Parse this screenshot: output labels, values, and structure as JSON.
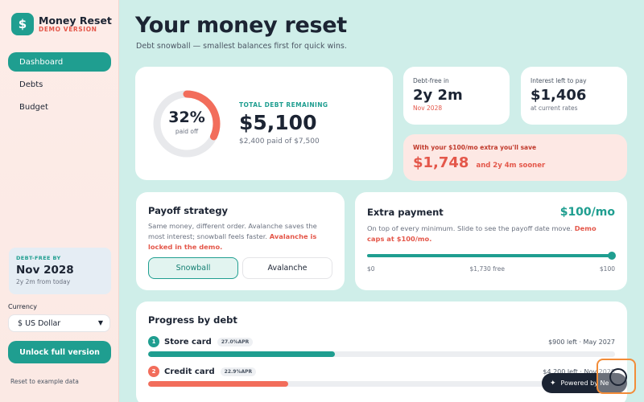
{
  "brand": {
    "logo_glyph": "$",
    "name": "Money Reset",
    "subtitle": "DEMO VERSION"
  },
  "nav": {
    "items": [
      {
        "label": "Dashboard",
        "active": true
      },
      {
        "label": "Debts",
        "active": false
      },
      {
        "label": "Budget",
        "active": false
      }
    ]
  },
  "sidebar_card": {
    "label": "DEBT-FREE BY",
    "value": "Nov 2028",
    "sub": "2y 2m from today"
  },
  "currency": {
    "label": "Currency",
    "selected": "$ US Dollar"
  },
  "unlock_label": "Unlock full version",
  "reset_label": "Reset to example data",
  "header": {
    "title": "Your money reset",
    "subtitle": "Debt snowball — smallest balances first for quick wins."
  },
  "total": {
    "percent_text": "32%",
    "percent": 32,
    "percent_sub": "paid off",
    "label": "TOTAL DEBT REMAINING",
    "value": "$5,100",
    "sub": "$2,400 paid of $7,500"
  },
  "debt_free": {
    "label": "Debt-free in",
    "value": "2y 2m",
    "sub": "Nov 2028"
  },
  "interest": {
    "label": "Interest left to pay",
    "value": "$1,406",
    "sub": "at current rates"
  },
  "savings": {
    "label": "With your $100/mo extra you'll save",
    "value": "$1,748",
    "sub": "and 2y 4m sooner"
  },
  "strategy": {
    "title": "Payoff strategy",
    "desc": "Same money, different order. Avalanche saves the most interest; snowball feels faster.",
    "warn": "Avalanche is locked in the demo.",
    "options": [
      "Snowball",
      "Avalanche"
    ],
    "selected": "Snowball"
  },
  "extra": {
    "title": "Extra payment",
    "value": "$100/mo",
    "desc": "On top of every minimum. Slide to see the payoff date move.",
    "warn": "Demo caps at $100/mo.",
    "slider_level": 1.0,
    "min_label": "$0",
    "mid_label": "$1,730 free",
    "max_label": "$100"
  },
  "progress": {
    "title": "Progress by debt",
    "debts": [
      {
        "num": "1",
        "name": "Store card",
        "apr": "27.0%APR",
        "right": "$900 left · May 2027",
        "paid_fraction": 0.4,
        "color": "#1f9e90"
      },
      {
        "num": "2",
        "name": "Credit card",
        "apr": "22.9%APR",
        "right": "$4,200 left · Nov 2028",
        "paid_fraction": 0.3,
        "color": "#f26d5b"
      }
    ]
  },
  "powered": {
    "label": "Powered by Ne"
  },
  "colors": {
    "teal": "#1f9e90",
    "coral": "#f26d5b",
    "ring_track": "#e8e9ec"
  }
}
